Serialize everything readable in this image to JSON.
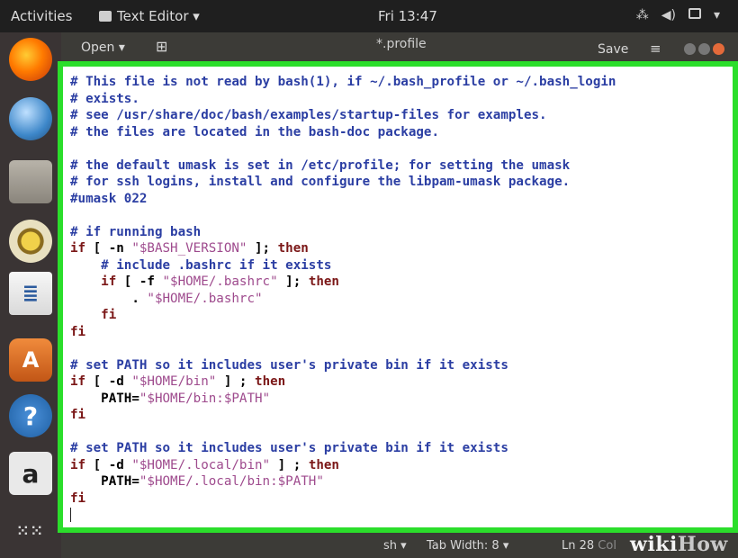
{
  "topbar": {
    "activities": "Activities",
    "app_menu": "Text Editor ▾",
    "clock": "Fri 13:47",
    "tray": [
      "⁂",
      "◀)",
      "▾"
    ]
  },
  "dock": {
    "apps": [
      {
        "name": "firefox-icon",
        "glyph": ""
      },
      {
        "name": "thunderbird-icon",
        "glyph": ""
      },
      {
        "name": "files-icon",
        "glyph": ""
      },
      {
        "name": "rhythmbox-icon",
        "glyph": ""
      },
      {
        "name": "libreoffice-writer-icon",
        "glyph": "≣"
      },
      {
        "name": "software-center-icon",
        "glyph": "A"
      },
      {
        "name": "help-icon",
        "glyph": "?"
      },
      {
        "name": "amazon-icon",
        "glyph": "a"
      },
      {
        "name": "show-apps-icon",
        "glyph": "⁙⁙"
      }
    ]
  },
  "header": {
    "open_label": "Open ▾",
    "recent_icon": "⊞",
    "title": "*.profile",
    "save_label": "Save",
    "menu_icon": "≡"
  },
  "code_lines": [
    "# This file is not read by bash(1), if ~/.bash_profile or ~/.bash_login",
    "# exists.",
    "# see /usr/share/doc/bash/examples/startup-files for examples.",
    "# the files are located in the bash-doc package.",
    "",
    "# the default umask is set in /etc/profile; for setting the umask",
    "# for ssh logins, install and configure the libpam-umask package.",
    "#umask 022",
    "",
    "# if running bash",
    "if [ -n \"$BASH_VERSION\" ]; then",
    "    # include .bashrc if it exists",
    "    if [ -f \"$HOME/.bashrc\" ]; then",
    "        . \"$HOME/.bashrc\"",
    "    fi",
    "fi",
    "",
    "# set PATH so it includes user's private bin if it exists",
    "if [ -d \"$HOME/bin\" ] ; then",
    "    PATH=\"$HOME/bin:$PATH\"",
    "fi",
    "",
    "# set PATH so it includes user's private bin if it exists",
    "if [ -d \"$HOME/.local/bin\" ] ; then",
    "    PATH=\"$HOME/.local/bin:$PATH\"",
    "fi",
    ""
  ],
  "status": {
    "language": "sh ▾",
    "tab_width": "Tab Width: 8 ▾",
    "line": "Ln 28",
    "col": "Col"
  },
  "watermark": {
    "wiki": "wiki",
    "how": "How"
  },
  "colors": {
    "frame": "#2bde2b",
    "comment": "#2b3ea3",
    "keyword": "#7b1717",
    "string": "#9e4a8d"
  }
}
